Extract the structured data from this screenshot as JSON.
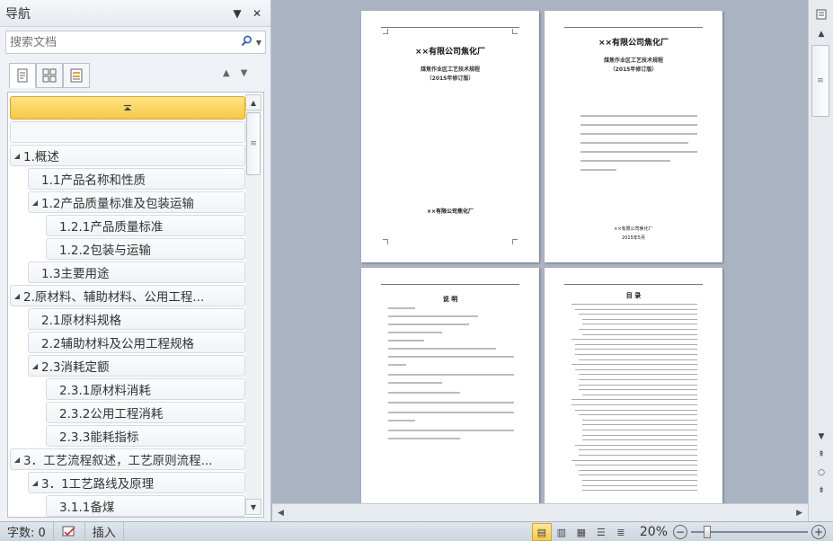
{
  "nav": {
    "title": "导航",
    "search_placeholder": "搜索文档",
    "items": [
      {
        "label": "1.概述",
        "level": 1,
        "expanded": true
      },
      {
        "label": "1.1产品名称和性质",
        "level": 2,
        "expanded": null
      },
      {
        "label": "1.2产品质量标准及包装运输",
        "level": 2,
        "expanded": true
      },
      {
        "label": "1.2.1产品质量标准",
        "level": 3,
        "expanded": null
      },
      {
        "label": "1.2.2包装与运输",
        "level": 3,
        "expanded": null
      },
      {
        "label": "1.3主要用途",
        "level": 2,
        "expanded": null
      },
      {
        "label": "2.原材料、辅助材料、公用工程...",
        "level": 1,
        "expanded": true
      },
      {
        "label": "2.1原材料规格",
        "level": 2,
        "expanded": null
      },
      {
        "label": "2.2辅助材料及公用工程规格",
        "level": 2,
        "expanded": null
      },
      {
        "label": "2.3消耗定额",
        "level": 2,
        "expanded": true
      },
      {
        "label": "2.3.1原材料消耗",
        "level": 3,
        "expanded": null
      },
      {
        "label": "2.3.2公用工程消耗",
        "level": 3,
        "expanded": null
      },
      {
        "label": "2.3.3能耗指标",
        "level": 3,
        "expanded": null
      },
      {
        "label": "3．工艺流程叙述，工艺原则流程...",
        "level": 1,
        "expanded": true
      },
      {
        "label": "3．1工艺路线及原理",
        "level": 2,
        "expanded": true
      },
      {
        "label": "3.1.1备煤",
        "level": 3,
        "expanded": null
      }
    ]
  },
  "pages": {
    "p1": {
      "title": "××有限公司焦化厂",
      "subtitle": "煤焦作业区工艺技术规程",
      "edition": "（2015年修订版）",
      "footer": "××有限公司焦化厂"
    },
    "p2": {
      "title": "××有限公司焦化厂",
      "subtitle": "煤焦作业区工艺技术规程",
      "edition": "（2015年修订版）",
      "footer": "××有限公司焦化厂",
      "date": "2015年5月"
    },
    "p3": {
      "title": "说 明"
    },
    "p4": {
      "title": "目 录"
    }
  },
  "status": {
    "word_count": "字数: 0",
    "mode": "插入",
    "zoom": "20%"
  },
  "colors": {
    "accent": "#f6c847",
    "doc_bg": "#a9b3c2",
    "pane_bg": "#eef1f6"
  }
}
